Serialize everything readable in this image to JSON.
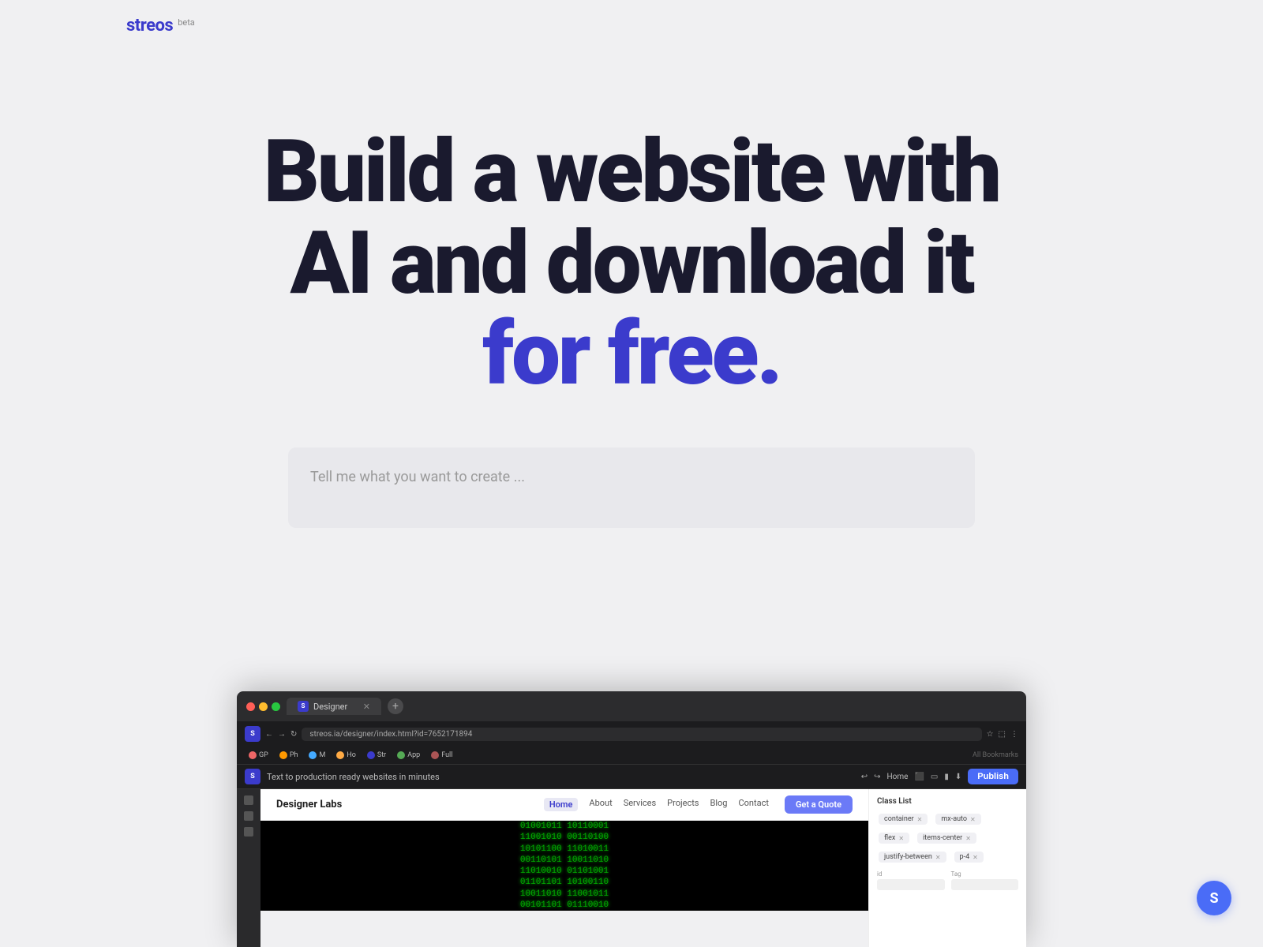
{
  "brand": {
    "logo": "streos",
    "beta": "beta",
    "color": "#3b3bcc"
  },
  "hero": {
    "title_line1": "Build a website with",
    "title_line2": "AI and download it",
    "title_line3": "for free.",
    "highlight_word": "for free."
  },
  "prompt": {
    "placeholder": "Tell me what you want to create ..."
  },
  "browser_preview": {
    "tab_label": "Designer",
    "tagline": "Text to production ready websites in minutes",
    "url": "streos.ia/designer/index.html?id=7652171894",
    "publish_button": "Publish",
    "website": {
      "logo": "Designer Labs",
      "nav_links": [
        "Home",
        "About",
        "Services",
        "Projects",
        "Blog",
        "Contact"
      ],
      "cta_button": "Get a Quote",
      "active_nav": "Home"
    },
    "right_panel": {
      "section_title": "Class List",
      "tags": [
        "container",
        "mx-auto",
        "flex",
        "items-center",
        "justify-between",
        "p-4"
      ],
      "field_labels": [
        "id",
        "Tag"
      ]
    }
  },
  "user_avatar": {
    "initial": "S",
    "color": "#4a6cf7"
  },
  "matrix_chars": "01001011 10110001\n11001010 00110100\n10101100 11010011\n00110101 10011010\n11010010 01101001\n01101101 10100110\n10011010 11001011\n00101101 01110010"
}
